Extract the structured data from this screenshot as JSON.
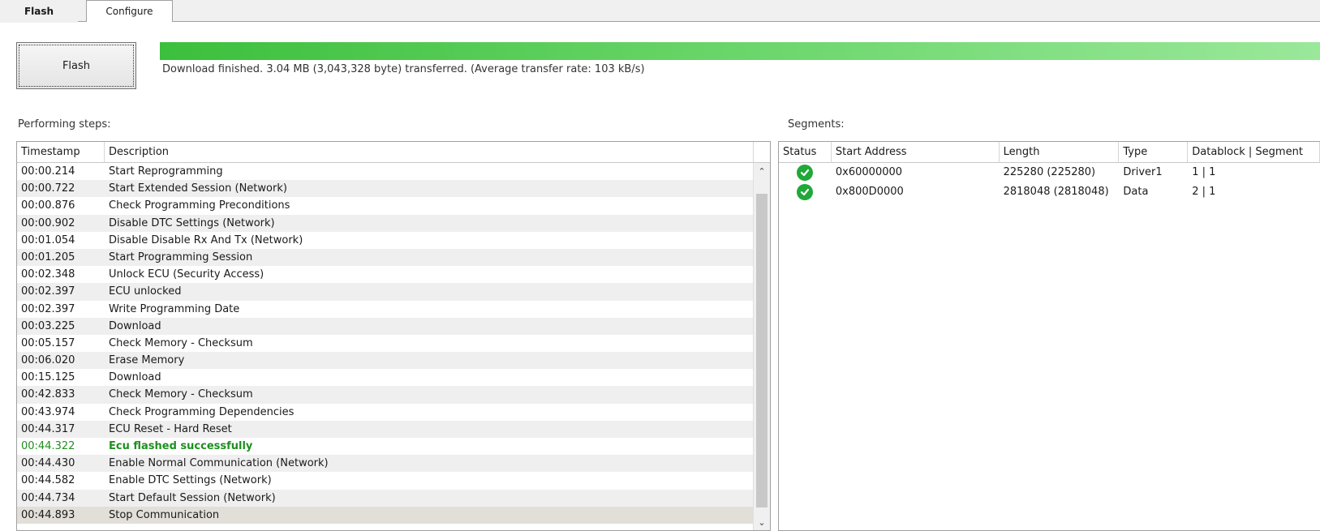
{
  "tabs": [
    {
      "label": "Flash",
      "active": true
    },
    {
      "label": "Configure",
      "active": false
    }
  ],
  "flash": {
    "button_label": "Flash",
    "progress_fraction": 1.0,
    "status_text": "Download finished. 3.04 MB (3,043,328 byte) transferred. (Average transfer rate: 103 kB/s)"
  },
  "steps": {
    "label": "Performing steps:",
    "columns": {
      "timestamp": "Timestamp",
      "description": "Description"
    },
    "rows": [
      {
        "timestamp": "00:00.214",
        "description": "Start Reprogramming"
      },
      {
        "timestamp": "00:00.722",
        "description": "Start Extended Session (Network)"
      },
      {
        "timestamp": "00:00.876",
        "description": "Check Programming Preconditions"
      },
      {
        "timestamp": "00:00.902",
        "description": "Disable DTC Settings (Network)"
      },
      {
        "timestamp": "00:01.054",
        "description": "Disable Disable Rx And Tx (Network)"
      },
      {
        "timestamp": "00:01.205",
        "description": "Start Programming Session"
      },
      {
        "timestamp": "00:02.348",
        "description": "Unlock ECU (Security Access)"
      },
      {
        "timestamp": "00:02.397",
        "description": "ECU unlocked"
      },
      {
        "timestamp": "00:02.397",
        "description": "Write Programming Date"
      },
      {
        "timestamp": "00:03.225",
        "description": "Download"
      },
      {
        "timestamp": "00:05.157",
        "description": "Check Memory - Checksum"
      },
      {
        "timestamp": "00:06.020",
        "description": "Erase Memory"
      },
      {
        "timestamp": "00:15.125",
        "description": "Download"
      },
      {
        "timestamp": "00:42.833",
        "description": "Check Memory - Checksum"
      },
      {
        "timestamp": "00:43.974",
        "description": "Check Programming Dependencies"
      },
      {
        "timestamp": "00:44.317",
        "description": "ECU Reset - Hard Reset"
      },
      {
        "timestamp": "00:44.322",
        "description": "Ecu flashed successfully",
        "status": "success"
      },
      {
        "timestamp": "00:44.430",
        "description": "Enable Normal Communication (Network)"
      },
      {
        "timestamp": "00:44.582",
        "description": "Enable DTC Settings (Network)"
      },
      {
        "timestamp": "00:44.734",
        "description": "Start Default Session (Network)"
      },
      {
        "timestamp": "00:44.893",
        "description": "Stop Communication",
        "selected": true
      }
    ],
    "scrollbar": {
      "up_glyph": "⌃",
      "down_glyph": "⌄"
    }
  },
  "segments": {
    "label": "Segments:",
    "columns": {
      "status": "Status",
      "start_address": "Start Address",
      "length": "Length",
      "type": "Type",
      "datablock_segment": "Datablock | Segment"
    },
    "rows": [
      {
        "status_icon": "check-circle-icon",
        "start_address": "0x60000000",
        "length": "225280 (225280)",
        "type": "Driver1",
        "datablock_segment": "1 | 1"
      },
      {
        "status_icon": "check-circle-icon",
        "start_address": "0x800D0000",
        "length": "2818048 (2818048)",
        "type": "Data",
        "datablock_segment": "2 | 1"
      }
    ]
  },
  "colors": {
    "success_text": "#1e8f1e",
    "progress_green": "#3cbf3c",
    "check_green": "#20a838"
  }
}
